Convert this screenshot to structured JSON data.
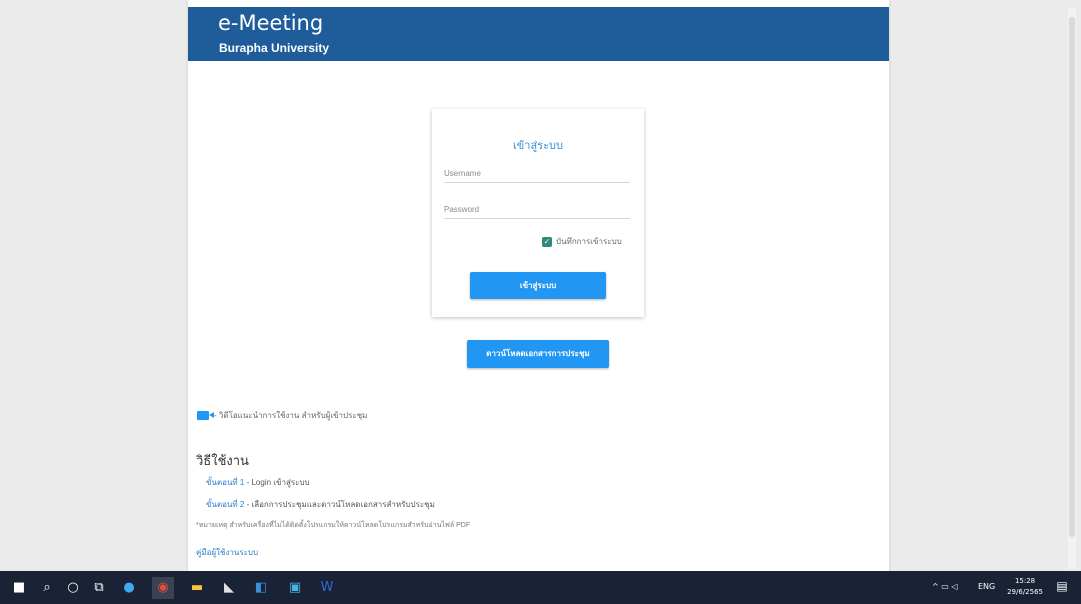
{
  "header": {
    "title": "e-Meeting",
    "subtitle": "Burapha University"
  },
  "login": {
    "title": "เข้าสู่ระบบ",
    "username_placeholder": "Username",
    "password_placeholder": "Password",
    "remember_label": "บันทึกการเข้าระบบ",
    "remember_checked": true,
    "submit_label": "เข้าสู่ระบบ"
  },
  "guide_button_label": "ดาวน์โหลดเอกสารการประชุม",
  "video_text": "- วิดีโอแนะนำการใช้งาน สำหรับผู้เข้าประชุม",
  "usage": {
    "title": "วิธีใช้งาน",
    "step1_label": "ขั้นตอนที่ 1",
    "step1_text": " - Login เข้าสู่ระบบ",
    "step2_label": "ขั้นตอนที่ 2",
    "step2_text": " - เลือกการประชุมและดาวน์โหลดเอกสารสำหรับประชุม",
    "note": "*หมายเหตุ สำหรับเครื่องที่ไม่ได้ติดตั้งโปรแกรมให้ดาวน์โหลดโปรแกรมสำหรับอ่านไฟล์ PDF",
    "manual_link": "คู่มือผู้ใช้งานระบบ"
  },
  "taskbar": {
    "time": "15:28",
    "date": "29/6/2565",
    "lang": "ENG",
    "icons": [
      "windows-start-icon",
      "search-icon",
      "cortana-icon",
      "task-view-icon",
      "edge-icon",
      "chrome-icon",
      "file-explorer-icon",
      "app-icon",
      "outlook-icon",
      "app-icon",
      "word-icon"
    ]
  },
  "colors": {
    "header": "#1f5c9a",
    "button": "#2196f3",
    "accent_text": "#3a8fd8",
    "checkbox": "#2e8b79"
  }
}
